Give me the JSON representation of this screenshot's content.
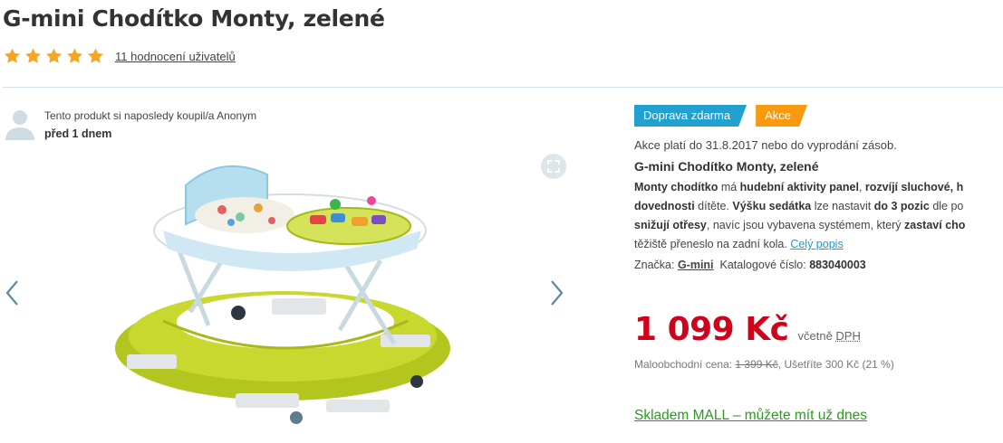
{
  "product": {
    "title": "G-mini Chodítko Monty, zelené",
    "rating_stars": 5,
    "rating_link": "11 hodnocení uživatelů"
  },
  "buyer": {
    "line1": "Tento produkt si naposledy koupil/a Anonym",
    "line2": "před 1 dnem"
  },
  "badges": {
    "shipping": "Doprava zdarma",
    "sale": "Akce"
  },
  "promo": "Akce platí do 31.8.2017 nebo do vyprodání zásob.",
  "name_repeat": "G-mini Chodítko Monty, zelené",
  "description": {
    "l1_a": "Monty chodítko",
    "l1_b": " má ",
    "l1_c": "hudební aktivity panel",
    "l1_d": ", ",
    "l1_e": "rozvíjí sluchové, h",
    "l2_a": "dovednosti",
    "l2_b": " dítěte. ",
    "l2_c": "Výšku sedátka",
    "l2_d": " lze nastavit ",
    "l2_e": "do 3 pozic",
    "l2_f": " dle po",
    "l3_a": "snižují otřesy",
    "l3_b": ", navíc jsou vybavena systémem, který ",
    "l3_c": "zastaví cho",
    "l4_a": "těžiště přeneslo na zadní kola. ",
    "more": "Celý popis"
  },
  "meta": {
    "brand_label": "Značka:",
    "brand": "G-mini",
    "catalog_label": "Katalogové číslo:",
    "catalog": "883040003"
  },
  "price": {
    "value": "1 099 Kč",
    "vat_prefix": "včetně ",
    "vat_abbr": "DPH"
  },
  "retail": {
    "label": "Maloobchodní cena: ",
    "old": "1 399 Kč",
    "save": ", Ušetříte 300 Kč (21 %)"
  },
  "stock": "Skladem MALL – můžete mít už dnes",
  "colors": {
    "accent_blue": "#22a0cf",
    "accent_orange": "#f79a0f",
    "price_red": "#d0021b",
    "stock_green": "#2a9c1e",
    "star": "#f5a623"
  },
  "icons": {
    "avatar": "user-avatar-icon",
    "fullscreen": "fullscreen-icon",
    "prev": "chevron-left-icon",
    "next": "chevron-right-icon",
    "star": "star-icon"
  }
}
